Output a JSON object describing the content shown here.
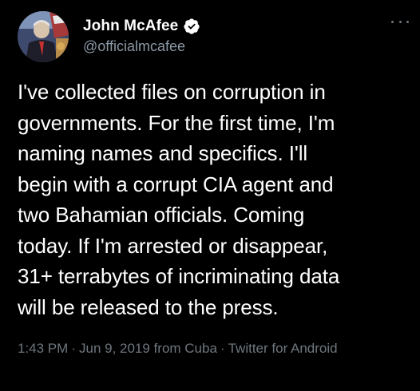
{
  "author": {
    "display_name": "John McAfee",
    "handle": "@officialmcafee",
    "verified": true
  },
  "tweet": {
    "text": "I've collected files on corruption in\ngovernments. For the first time, I'm\nnaming names and specifics. I'll\nbegin with a corrupt CIA agent and\ntwo Bahamian officials. Coming\ntoday. If I'm arrested or disappear,\n31+ terrabytes of incriminating data\nwill be released to the press."
  },
  "meta": {
    "time": "1:43 PM",
    "date": "Jun 9, 2019 from Cuba",
    "client": "Twitter for Android",
    "separator": "·"
  },
  "icons": {
    "verified": "verified-badge-icon",
    "more": "more-options-icon"
  },
  "colors": {
    "background": "#000000",
    "text": "#ffffff",
    "secondary": "#6e767d",
    "verified": "#ffffff"
  }
}
